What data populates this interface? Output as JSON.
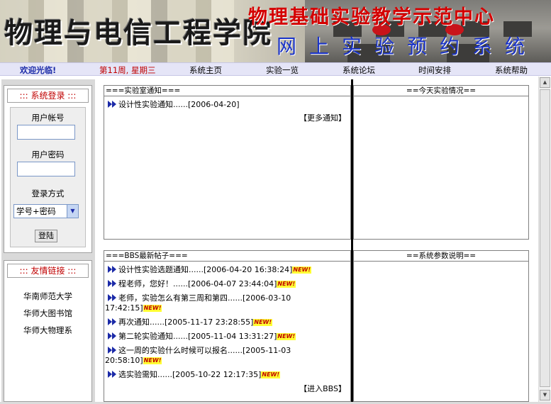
{
  "banner": {
    "college_title": "物理与电信工程学院",
    "center_title": "物理基础实验教学示范中心",
    "system_title": "网上实验预约系统"
  },
  "nav": {
    "welcome": "欢迎光临!",
    "week": "第11周, 星期三",
    "links": [
      "系统主页",
      "实验一览",
      "系统论坛",
      "时间安排",
      "系统帮助"
    ]
  },
  "login": {
    "title": "::: 系统登录 :::",
    "account_label": "用户帐号",
    "account_value": "",
    "password_label": "用户密码",
    "password_value": "",
    "method_label": "登录方式",
    "method_selected": "学号+密码",
    "submit_label": "登陆"
  },
  "friend_links": {
    "title": "::: 友情链接 :::",
    "items": [
      "华南师范大学",
      "华师大图书馆",
      "华师大物理系"
    ]
  },
  "notice_panel": {
    "title": "===实验室通知===",
    "items": [
      "设计性实验通知......[2006-04-20]"
    ],
    "more": "【更多通知】"
  },
  "today_panel": {
    "title": "==今天实验情况=="
  },
  "bbs_panel": {
    "title": "===BBS最新帖子===",
    "items": [
      {
        "line1": "设计性实验选题通知......[2006-04-20 16:38:24]",
        "line2": ""
      },
      {
        "line1": "程老师，您好！......[2006-04-07 23:44:04]",
        "line2": ""
      },
      {
        "line1": "老师，实验怎么有第三周和第四......[2006-03-10",
        "line2": "17:42:15]"
      },
      {
        "line1": "再次通知......[2005-11-17 23:28:55]",
        "line2": ""
      },
      {
        "line1": "第二轮实验通知......[2005-11-04 13:31:27]",
        "line2": ""
      },
      {
        "line1": "这一周的实验什么时候可以报名......[2005-11-03",
        "line2": "20:58:10]"
      },
      {
        "line1": "选实验需知......[2005-10-22 12:17:35]",
        "line2": ""
      }
    ],
    "new_badge": "NEW!",
    "more": "【进入BBS】"
  },
  "params_panel": {
    "title": "==系统参数说明=="
  }
}
